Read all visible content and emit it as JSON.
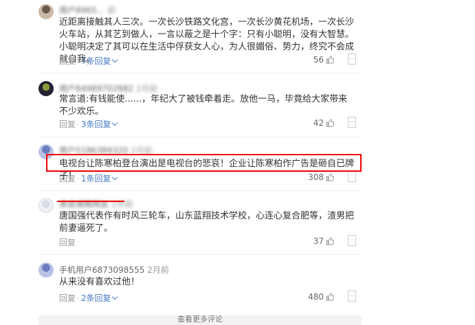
{
  "comments": [
    {
      "user": "用户8965…",
      "time": "前",
      "text": "近距离接触其人三次。一次长沙铁路文化宫，一次长沙黄花机场，一次长沙火车站，从其艺到做人，一言以蔽之是十个字：只有小聪明，没有大智慧。小聪明决定了其可以在生活中俘获女人心，为人很媚俗、势力，终究不会成就自我。",
      "reply": "回复",
      "reply_count": "7条回复",
      "likes": "56"
    },
    {
      "user": "用户8498970288​2",
      "time": "2月前",
      "text": "常言道:有钱能使......，年纪大了被钱牵着走。放他一马，毕竟给大家带来不少欢乐。",
      "reply": "回复",
      "reply_count": "3条回复",
      "likes": "42"
    },
    {
      "user": "用户5186389320",
      "time": "2月前",
      "text": "电视台让陈寒柏登台演出是电视台的悲哀！企业让陈寒柏作广告是砸自已牌子！",
      "reply": "回复",
      "reply_count": "1条回复",
      "likes": "308"
    },
    {
      "user": "来自湖南网友",
      "time": "2月前",
      "text": "唐国强代表作有时风三轮车，山东蓝翔技术学校，心连心复合肥等，渣男把前妻逼死了。",
      "reply": "回复",
      "reply_count": "",
      "likes": "37"
    },
    {
      "user": "手机用户6873098555",
      "time": "2月前",
      "text": "从来没有喜欢过他！",
      "reply": "回复",
      "reply_count": "2条回复",
      "likes": "480"
    }
  ],
  "more_comments": "查看更多评论",
  "colors": {
    "highlight": "#e00000",
    "link": "#4b7cc1"
  }
}
